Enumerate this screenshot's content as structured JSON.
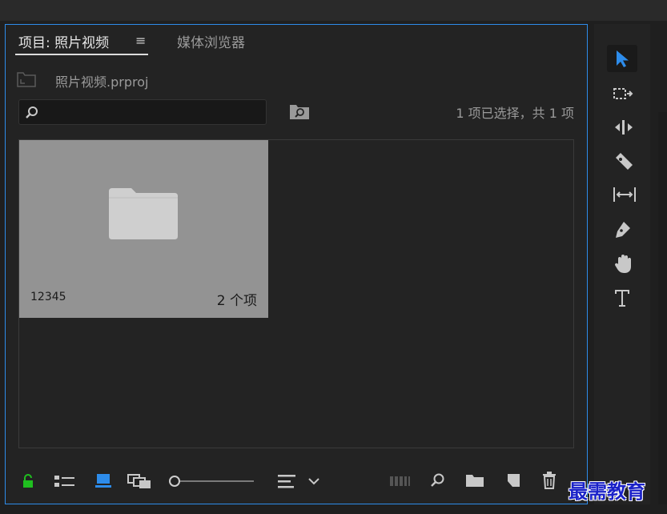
{
  "tabs": {
    "project_label": "项目: 照片视频",
    "media_browser_label": "媒体浏览器",
    "menu_glyph": "≡"
  },
  "project": {
    "file_name": "照片视频.prproj",
    "selection_status": "1 项已选择，共 1 项"
  },
  "search": {
    "value": "",
    "placeholder": ""
  },
  "bin": {
    "name": "12345",
    "item_count": "2 个项"
  },
  "bottom_bar": {
    "icons": [
      "lock-icon",
      "list-view-icon",
      "icon-view-icon",
      "freeform-view-icon",
      "zoom-slider",
      "sort-icon",
      "sort-dropdown-icon",
      "automate-to-sequence-icon",
      "find-icon",
      "new-bin-icon",
      "new-item-icon",
      "clear-icon"
    ]
  },
  "tools": {
    "items": [
      "selection-tool",
      "track-select-tool",
      "ripple-edit-tool",
      "razor-tool",
      "slip-tool",
      "pen-tool",
      "hand-tool",
      "type-tool"
    ],
    "active": "selection-tool"
  },
  "watermark": "最需教育",
  "colors": {
    "accent": "#2d8ceb",
    "lock_green": "#1fbf1f",
    "watermark_blue": "#1b22c8"
  }
}
